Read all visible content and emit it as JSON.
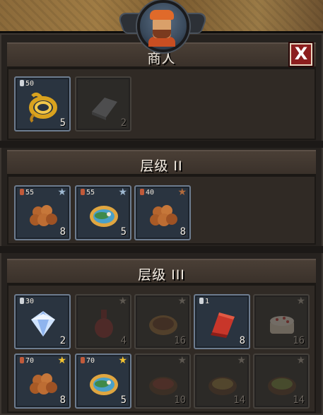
{
  "merchant": {
    "title": "商人",
    "close_label": "X",
    "items": [
      {
        "price": "50",
        "coin": "silver",
        "qty": "5",
        "icon": "gold-rope-icon",
        "available": true
      },
      {
        "price": "",
        "coin": "",
        "qty": "2",
        "icon": "iron-ingot-icon",
        "available": false
      }
    ]
  },
  "tier2": {
    "title": "层级 II",
    "items": [
      {
        "price": "55",
        "coin": "copper",
        "qty": "8",
        "icon": "nuts-icon",
        "star": "silver",
        "available": true
      },
      {
        "price": "55",
        "coin": "copper",
        "qty": "5",
        "icon": "fish-platter-icon",
        "star": "silver",
        "available": true
      },
      {
        "price": "40",
        "coin": "copper",
        "qty": "8",
        "icon": "nuts-icon",
        "star": "bronze",
        "available": true
      }
    ]
  },
  "tier3": {
    "title": "层级 III",
    "row1": [
      {
        "price": "30",
        "coin": "silver",
        "qty": "2",
        "icon": "diamond-icon",
        "star": "",
        "available": true
      },
      {
        "price": "",
        "coin": "",
        "qty": "4",
        "icon": "wine-bottle-icon",
        "star": "dim",
        "available": false
      },
      {
        "price": "",
        "coin": "",
        "qty": "16",
        "icon": "pie-icon",
        "star": "dim",
        "available": false
      },
      {
        "price": "1",
        "coin": "silver",
        "qty": "8",
        "icon": "red-cloth-icon",
        "star": "",
        "available": true
      },
      {
        "price": "",
        "coin": "",
        "qty": "16",
        "icon": "cake-icon",
        "star": "dim",
        "available": false
      }
    ],
    "row2": [
      {
        "price": "70",
        "coin": "copper",
        "qty": "8",
        "icon": "nuts-icon",
        "star": "gold",
        "available": true
      },
      {
        "price": "70",
        "coin": "copper",
        "qty": "5",
        "icon": "fish-platter-icon",
        "star": "gold",
        "available": true
      },
      {
        "price": "",
        "coin": "",
        "qty": "10",
        "icon": "stew-bowl-icon",
        "star": "dim",
        "available": false
      },
      {
        "price": "",
        "coin": "",
        "qty": "14",
        "icon": "soup-bowl-icon",
        "star": "dim",
        "available": false
      },
      {
        "price": "",
        "coin": "",
        "qty": "14",
        "icon": "soup-bowl-icon",
        "star": "dim",
        "available": false
      }
    ]
  },
  "colors": {
    "star_gold": "#f2c230",
    "star_silver": "#9fb8d0",
    "star_bronze": "#b06a3c",
    "star_dim": "#5c5750"
  }
}
